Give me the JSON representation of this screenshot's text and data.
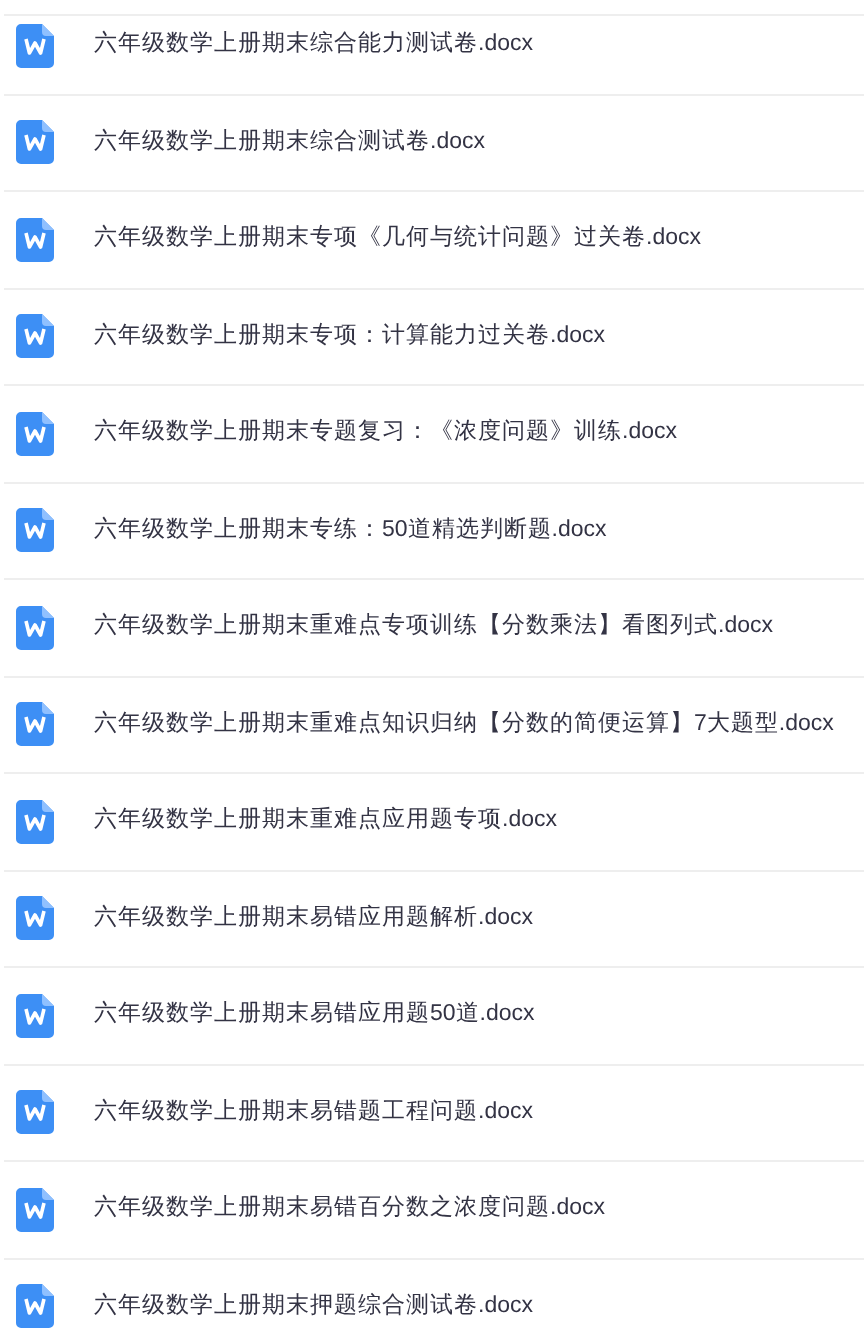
{
  "files": [
    {
      "name": "六年级数学上册期末综合能力测试卷.docx"
    },
    {
      "name": "六年级数学上册期末综合测试卷.docx"
    },
    {
      "name": "六年级数学上册期末专项《几何与统计问题》过关卷.docx"
    },
    {
      "name": "六年级数学上册期末专项：计算能力过关卷.docx"
    },
    {
      "name": "六年级数学上册期末专题复习：《浓度问题》训练.docx"
    },
    {
      "name": "六年级数学上册期末专练：50道精选判断题.docx"
    },
    {
      "name": "六年级数学上册期末重难点专项训练【分数乘法】看图列式.docx"
    },
    {
      "name": "六年级数学上册期末重难点知识归纳【分数的简便运算】7大题型.docx"
    },
    {
      "name": "六年级数学上册期末重难点应用题专项.docx"
    },
    {
      "name": "六年级数学上册期末易错应用题解析.docx"
    },
    {
      "name": "六年级数学上册期末易错应用题50道.docx"
    },
    {
      "name": "六年级数学上册期末易错题工程问题.docx"
    },
    {
      "name": "六年级数学上册期末易错百分数之浓度问题.docx"
    },
    {
      "name": "六年级数学上册期末押题综合测试卷.docx"
    }
  ]
}
